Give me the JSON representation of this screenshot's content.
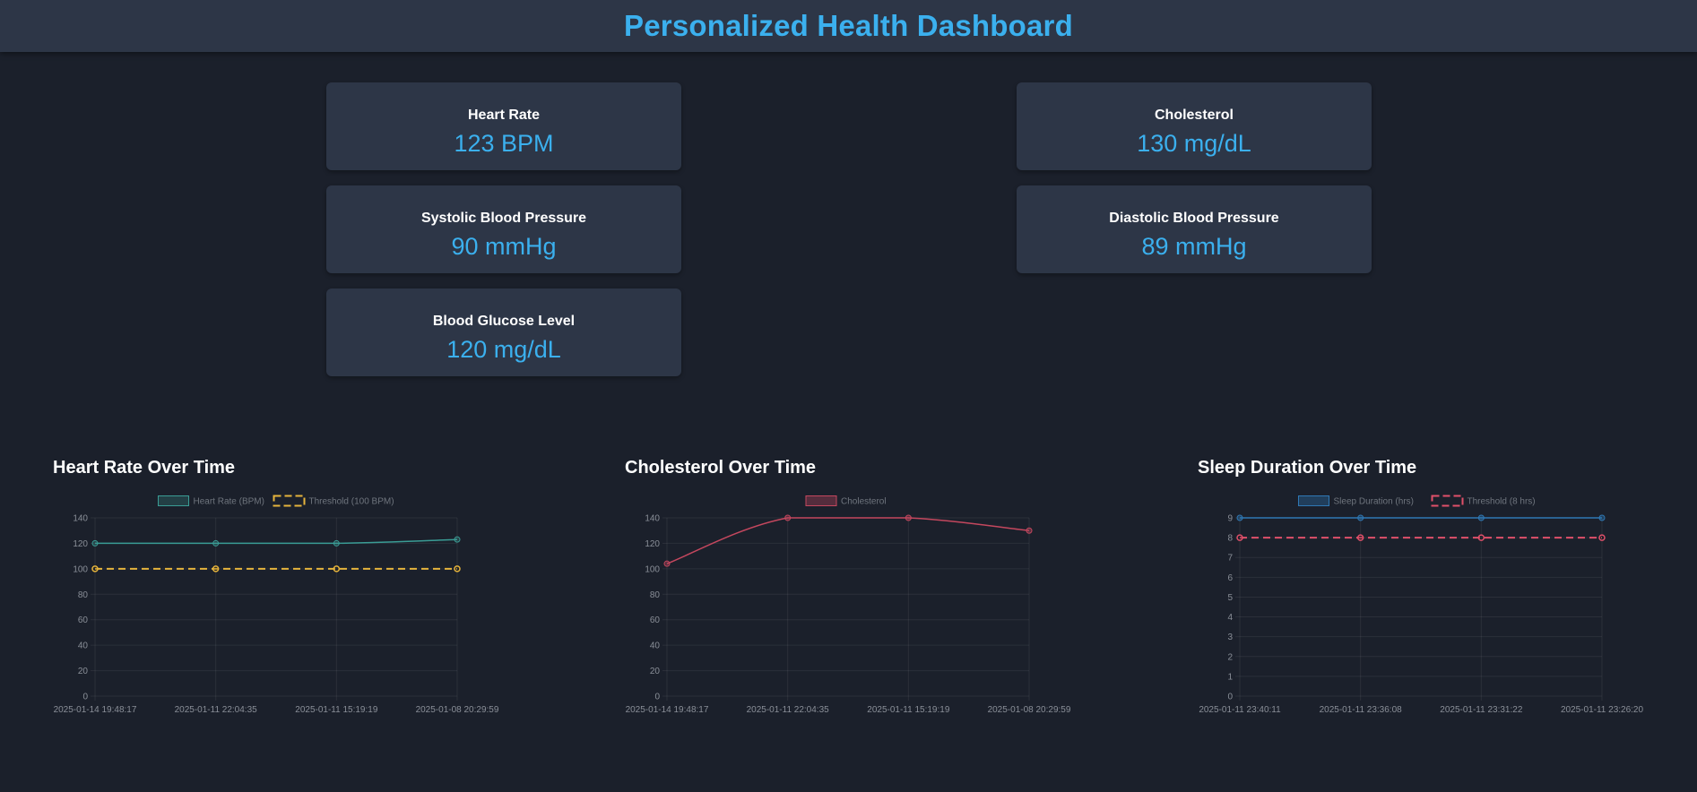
{
  "header": {
    "title": "Personalized Health Dashboard"
  },
  "cards": [
    {
      "label": "Heart Rate",
      "value": "123 BPM"
    },
    {
      "label": "Cholesterol",
      "value": "130 mg/dL"
    },
    {
      "label": "Systolic Blood Pressure",
      "value": "90 mmHg"
    },
    {
      "label": "Diastolic Blood Pressure",
      "value": "89 mmHg"
    },
    {
      "label": "Blood Glucose Level",
      "value": "120 mg/dL"
    }
  ],
  "colors": {
    "background": "#1b202b",
    "panel": "#2d3647",
    "accent": "#3bb0ee",
    "teal": "#3a9c95",
    "yellow": "#e6b43c",
    "pink": "#c4475e",
    "blue": "#2f78b4",
    "pink_threshold": "#e0506a"
  },
  "chart_data": [
    {
      "type": "line",
      "title": "Heart Rate Over Time",
      "x": [
        "2025-01-14 19:48:17",
        "2025-01-11 22:04:35",
        "2025-01-11 15:19:19",
        "2025-01-08 20:29:59"
      ],
      "series": [
        {
          "name": "Heart Rate (BPM)",
          "values": [
            120,
            120,
            120,
            123
          ],
          "color": "#3a9c95",
          "dashed": false,
          "fill": "rgba(58,156,149,0.25)"
        },
        {
          "name": "Threshold (100 BPM)",
          "values": [
            100,
            100,
            100,
            100
          ],
          "color": "#e6b43c",
          "dashed": true,
          "fill": "rgba(0,0,0,0)"
        }
      ],
      "yticks": [
        0,
        20,
        40,
        60,
        80,
        100,
        120,
        140
      ],
      "ylim": [
        0,
        140
      ],
      "grid": true,
      "legend": "top-center"
    },
    {
      "type": "line",
      "title": "Cholesterol Over Time",
      "x": [
        "2025-01-14 19:48:17",
        "2025-01-11 22:04:35",
        "2025-01-11 15:19:19",
        "2025-01-08 20:29:59"
      ],
      "series": [
        {
          "name": "Cholesterol",
          "values": [
            104,
            140,
            140,
            130
          ],
          "color": "#c4475e",
          "dashed": false,
          "fill": "rgba(196,71,94,0.35)"
        }
      ],
      "yticks": [
        0,
        20,
        40,
        60,
        80,
        100,
        120,
        140
      ],
      "ylim": [
        0,
        140
      ],
      "grid": true,
      "legend": "top-center"
    },
    {
      "type": "line",
      "title": "Sleep Duration Over Time",
      "x": [
        "2025-01-11 23:40:11",
        "2025-01-11 23:36:08",
        "2025-01-11 23:31:22",
        "2025-01-11 23:26:20"
      ],
      "series": [
        {
          "name": "Sleep Duration (hrs)",
          "values": [
            9,
            9,
            9,
            9
          ],
          "color": "#2f78b4",
          "dashed": false,
          "fill": "rgba(47,120,180,0.35)"
        },
        {
          "name": "Threshold (8 hrs)",
          "values": [
            8,
            8,
            8,
            8
          ],
          "color": "#e0506a",
          "dashed": true,
          "fill": "rgba(0,0,0,0)"
        }
      ],
      "yticks": [
        0,
        1,
        2,
        3,
        4,
        5,
        6,
        7,
        8,
        9
      ],
      "ylim": [
        0,
        9
      ],
      "grid": true,
      "legend": "top-center"
    }
  ]
}
